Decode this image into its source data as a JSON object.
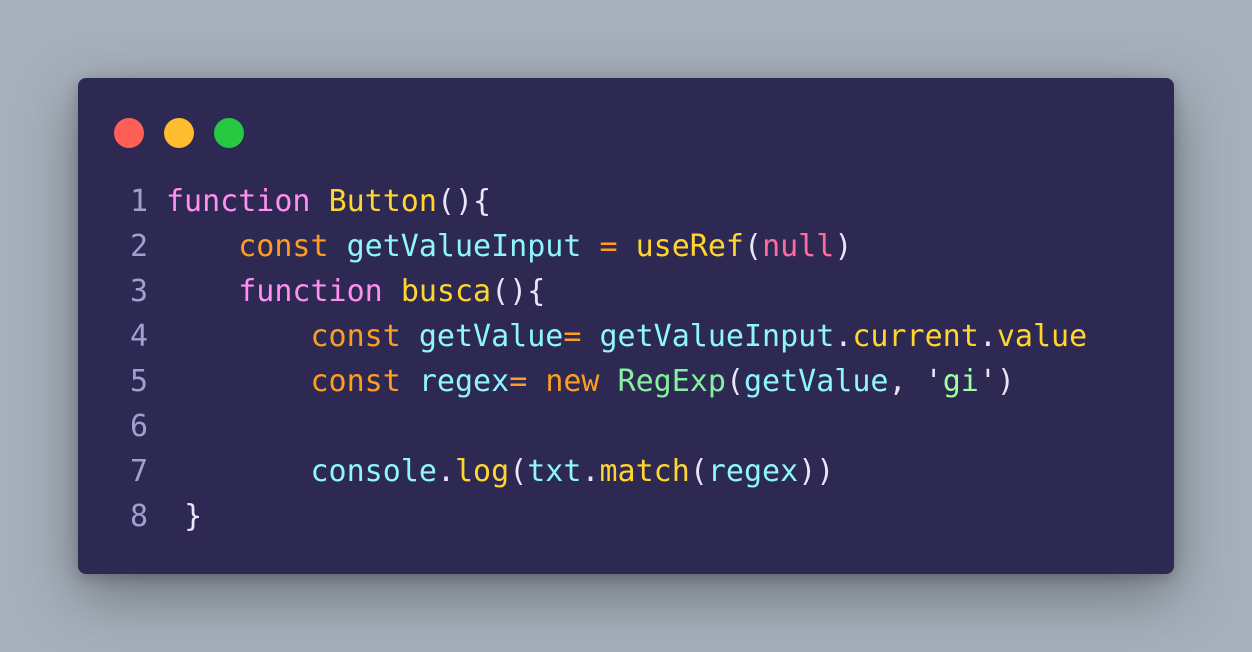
{
  "window": {
    "dots": [
      {
        "name": "close-dot",
        "color": "#ff5f57"
      },
      {
        "name": "minimize-dot",
        "color": "#febc2e"
      },
      {
        "name": "maximize-dot",
        "color": "#28c840"
      }
    ]
  },
  "colors": {
    "background": "#a6b0bb",
    "editor": "#2d2953",
    "line_number": "#a19fd2",
    "keyword_pink": "#ff8ff0",
    "keyword_orange": "#ff9d1f",
    "function_name": "#ffd52e",
    "identifier": "#8ff5ff",
    "string": "#9dff9d",
    "class_name": "#85f0a0",
    "null": "#ff6b9d",
    "punctuation": "#e8e6f7"
  },
  "code": {
    "lines": [
      {
        "number": "1",
        "indent": "",
        "tokens": [
          {
            "t": "function",
            "c": "#ff8ff0"
          },
          {
            "t": " ",
            "c": "#e8e6f7"
          },
          {
            "t": "Button",
            "c": "#ffd52e"
          },
          {
            "t": "(){",
            "c": "#e8e6f7"
          }
        ]
      },
      {
        "number": "2",
        "indent": "    ",
        "tokens": [
          {
            "t": "const",
            "c": "#ff9d1f"
          },
          {
            "t": " ",
            "c": "#e8e6f7"
          },
          {
            "t": "getValueInput",
            "c": "#8ff5ff"
          },
          {
            "t": " = ",
            "c": "#ff9d1f"
          },
          {
            "t": "useRef",
            "c": "#ffd52e"
          },
          {
            "t": "(",
            "c": "#e8e6f7"
          },
          {
            "t": "null",
            "c": "#ff6b9d"
          },
          {
            "t": ")",
            "c": "#e8e6f7"
          }
        ]
      },
      {
        "number": "3",
        "indent": "    ",
        "tokens": [
          {
            "t": "function",
            "c": "#ff8ff0"
          },
          {
            "t": " ",
            "c": "#e8e6f7"
          },
          {
            "t": "busca",
            "c": "#ffd52e"
          },
          {
            "t": "(){",
            "c": "#e8e6f7"
          }
        ]
      },
      {
        "number": "4",
        "indent": "        ",
        "tokens": [
          {
            "t": "const",
            "c": "#ff9d1f"
          },
          {
            "t": " ",
            "c": "#e8e6f7"
          },
          {
            "t": "getValue",
            "c": "#8ff5ff"
          },
          {
            "t": "= ",
            "c": "#ff9d1f"
          },
          {
            "t": "getValueInput",
            "c": "#8ff5ff"
          },
          {
            "t": ".",
            "c": "#e8e6f7"
          },
          {
            "t": "current",
            "c": "#ffd52e"
          },
          {
            "t": ".",
            "c": "#e8e6f7"
          },
          {
            "t": "value",
            "c": "#ffd52e"
          }
        ]
      },
      {
        "number": "5",
        "indent": "        ",
        "tokens": [
          {
            "t": "const",
            "c": "#ff9d1f"
          },
          {
            "t": " ",
            "c": "#e8e6f7"
          },
          {
            "t": "regex",
            "c": "#8ff5ff"
          },
          {
            "t": "= ",
            "c": "#ff9d1f"
          },
          {
            "t": "new",
            "c": "#ff9d1f"
          },
          {
            "t": " ",
            "c": "#e8e6f7"
          },
          {
            "t": "RegExp",
            "c": "#85f0a0"
          },
          {
            "t": "(",
            "c": "#e8e6f7"
          },
          {
            "t": "getValue",
            "c": "#8ff5ff"
          },
          {
            "t": ", ",
            "c": "#e8e6f7"
          },
          {
            "t": "'",
            "c": "#e8e6f7"
          },
          {
            "t": "gi",
            "c": "#9dff9d"
          },
          {
            "t": "'",
            "c": "#e8e6f7"
          },
          {
            "t": ")",
            "c": "#e8e6f7"
          }
        ]
      },
      {
        "number": "6",
        "indent": "",
        "tokens": []
      },
      {
        "number": "7",
        "indent": "        ",
        "tokens": [
          {
            "t": "console",
            "c": "#8ff5ff"
          },
          {
            "t": ".",
            "c": "#e8e6f7"
          },
          {
            "t": "log",
            "c": "#ffd52e"
          },
          {
            "t": "(",
            "c": "#e8e6f7"
          },
          {
            "t": "txt",
            "c": "#8ff5ff"
          },
          {
            "t": ".",
            "c": "#e8e6f7"
          },
          {
            "t": "match",
            "c": "#ffd52e"
          },
          {
            "t": "(",
            "c": "#e8e6f7"
          },
          {
            "t": "regex",
            "c": "#8ff5ff"
          },
          {
            "t": "))",
            "c": "#e8e6f7"
          }
        ]
      },
      {
        "number": "8",
        "indent": " ",
        "tokens": [
          {
            "t": "}",
            "c": "#e8e6f7"
          }
        ]
      }
    ]
  }
}
